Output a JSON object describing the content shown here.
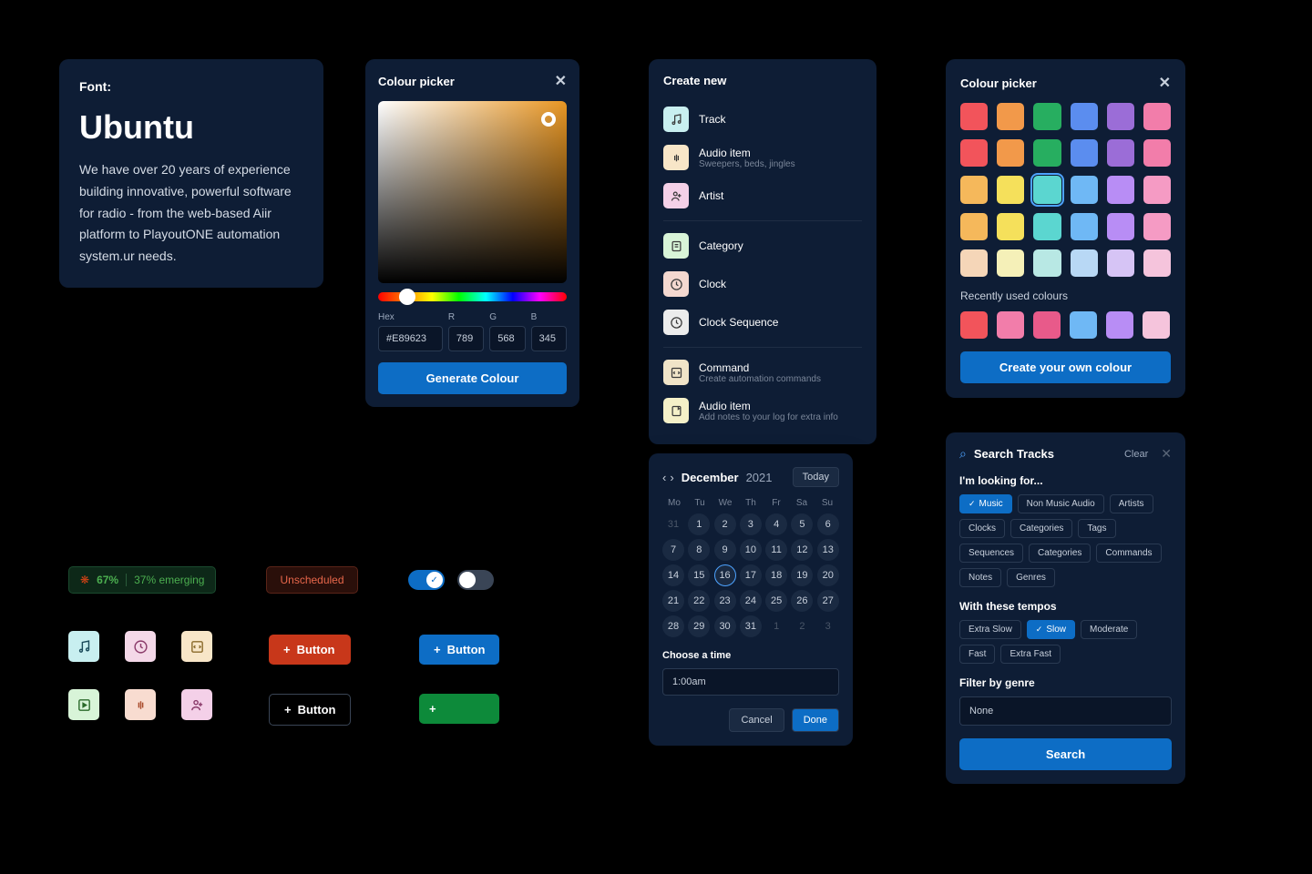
{
  "font_card": {
    "label": "Font:",
    "name": "Ubuntu",
    "desc": "We have over 20 years of experience building innovative, powerful software for radio - from the web-based Aiir platform to PlayoutONE automation system.ur needs."
  },
  "picker1": {
    "title": "Colour picker",
    "hex_lbl": "Hex",
    "r_lbl": "R",
    "g_lbl": "G",
    "b_lbl": "B",
    "hex": "#E89623",
    "r": "789",
    "g": "568",
    "b": "345",
    "btn": "Generate Colour"
  },
  "create": {
    "title": "Create new",
    "items": [
      {
        "label": "Track",
        "color": "#c8eff0",
        "icon": "music"
      },
      {
        "label": "Audio item",
        "sub": "Sweepers, beds, jingles",
        "color": "#f8e6c8",
        "icon": "wave"
      },
      {
        "label": "Artist",
        "color": "#f4d0e8",
        "icon": "person"
      },
      {
        "label": "Category",
        "color": "#d8f4d8",
        "icon": "doc"
      },
      {
        "label": "Clock",
        "color": "#f4d8d0",
        "icon": "clock"
      },
      {
        "label": "Clock Sequence",
        "color": "#ececec",
        "icon": "seq"
      },
      {
        "label": "Command",
        "sub": "Create automation commands",
        "color": "#f0e4c8",
        "icon": "code"
      },
      {
        "label": "Audio item",
        "sub": "Add notes to your log for extra info",
        "color": "#f4f0c8",
        "icon": "note"
      }
    ]
  },
  "picker2": {
    "title": "Colour picker",
    "recent_lbl": "Recently used colours",
    "btn": "Create your own colour",
    "swatches": [
      "#f2545b",
      "#f2994a",
      "#27ae60",
      "#5b8def",
      "#9b6dd7",
      "#f27daa",
      "#f2545b",
      "#f2994a",
      "#27ae60",
      "#5b8def",
      "#9b6dd7",
      "#f27daa",
      "#f5b85b",
      "#f5e05b",
      "#5bd6d0",
      "#6fb8f5",
      "#b88df5",
      "#f59bc4",
      "#f5b85b",
      "#f5e05b",
      "#5bd6d0",
      "#6fb8f5",
      "#b88df5",
      "#f59bc4",
      "#f5d6b8",
      "#f5f0b8",
      "#b8e8e4",
      "#b8d8f5",
      "#d6c4f5",
      "#f5c4dc"
    ],
    "recent": [
      "#f2545b",
      "#f27daa",
      "#e85a8a",
      "#6fb8f5",
      "#b88df5",
      "#f5c4dc"
    ]
  },
  "chips": {
    "pct": "67%",
    "emerging": "37% emerging",
    "unscheduled": "Unscheduled"
  },
  "buttons": {
    "label": "Button"
  },
  "cal": {
    "month": "December",
    "year": "2021",
    "today": "Today",
    "dow": [
      "Mo",
      "Tu",
      "We",
      "Th",
      "Fr",
      "Sa",
      "Su"
    ],
    "days": [
      {
        "n": "31",
        "m": 1
      },
      {
        "n": "1"
      },
      {
        "n": "2"
      },
      {
        "n": "3"
      },
      {
        "n": "4"
      },
      {
        "n": "5"
      },
      {
        "n": "6"
      },
      {
        "n": "7"
      },
      {
        "n": "8"
      },
      {
        "n": "9"
      },
      {
        "n": "10"
      },
      {
        "n": "11"
      },
      {
        "n": "12"
      },
      {
        "n": "13"
      },
      {
        "n": "14"
      },
      {
        "n": "15"
      },
      {
        "n": "16",
        "s": 1
      },
      {
        "n": "17"
      },
      {
        "n": "18"
      },
      {
        "n": "19"
      },
      {
        "n": "20"
      },
      {
        "n": "21"
      },
      {
        "n": "22"
      },
      {
        "n": "23"
      },
      {
        "n": "24"
      },
      {
        "n": "25"
      },
      {
        "n": "26"
      },
      {
        "n": "27"
      },
      {
        "n": "28"
      },
      {
        "n": "29"
      },
      {
        "n": "30"
      },
      {
        "n": "31"
      },
      {
        "n": "1",
        "m": 1
      },
      {
        "n": "2",
        "m": 1
      },
      {
        "n": "3",
        "m": 1
      }
    ],
    "time_lbl": "Choose a time",
    "time": "1:00am",
    "cancel": "Cancel",
    "done": "Done"
  },
  "search": {
    "title": "Search Tracks",
    "clear": "Clear",
    "looking": "I'm looking for...",
    "cats": [
      "Music",
      "Non Music Audio",
      "Artists",
      "Clocks",
      "Categories",
      "Tags",
      "Sequences",
      "Categories",
      "Commands",
      "Notes",
      "Genres"
    ],
    "tempo_lbl": "With these tempos",
    "tempos": [
      "Extra Slow",
      "Slow",
      "Moderate",
      "Fast",
      "Extra Fast"
    ],
    "genre_lbl": "Filter by genre",
    "genre": "None",
    "btn": "Search"
  }
}
